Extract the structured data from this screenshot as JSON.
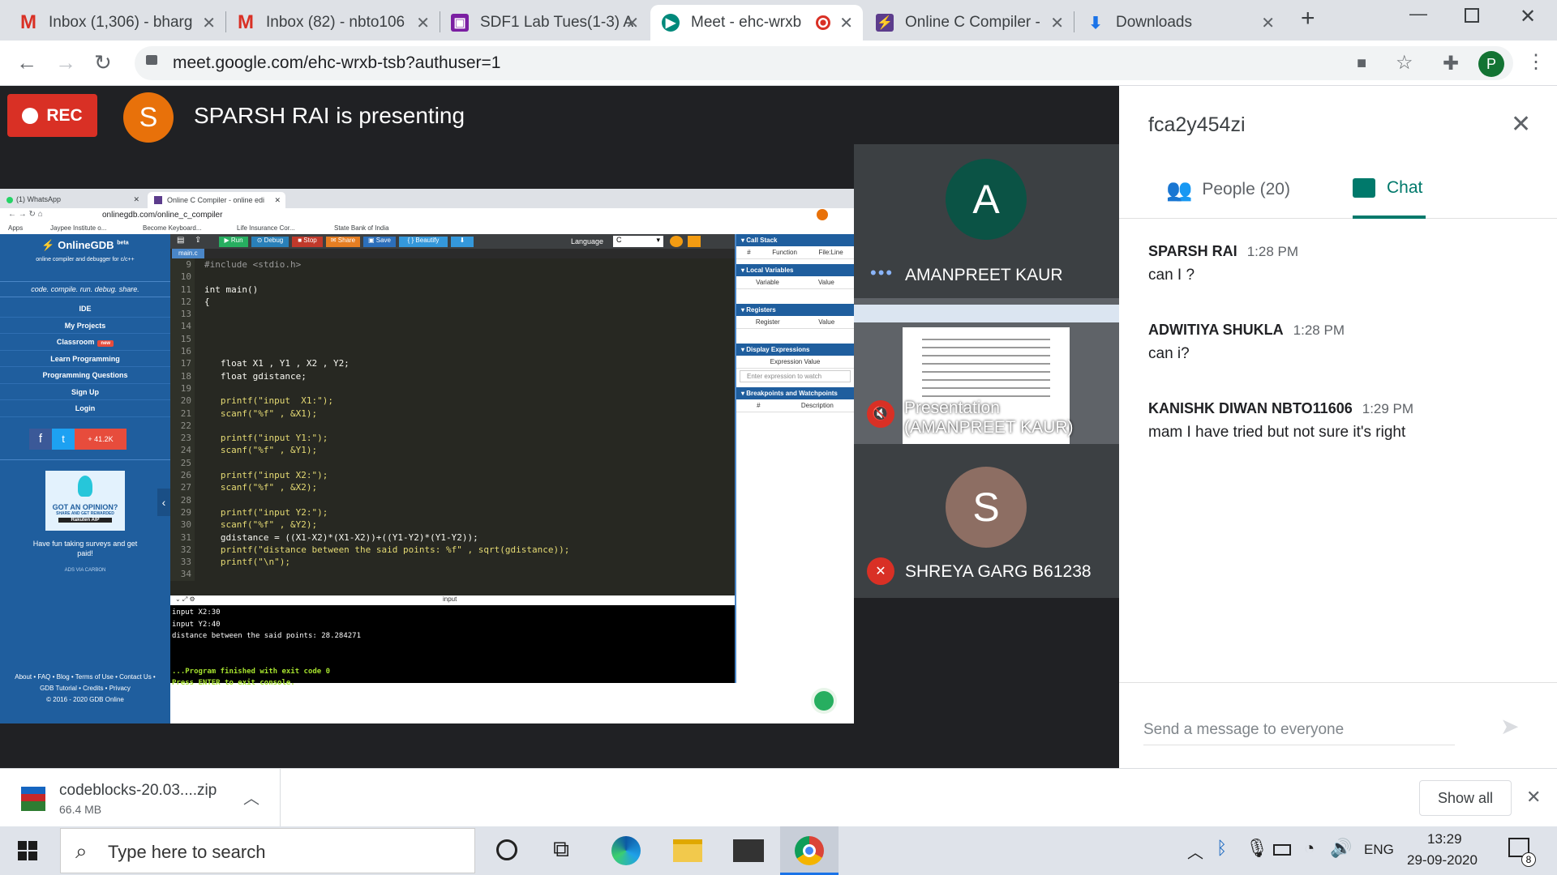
{
  "browser": {
    "tabs": [
      {
        "title": "Inbox (1,306) - bharg",
        "icon": "gmail-icon",
        "active": false
      },
      {
        "title": "Inbox (82) - nbto106",
        "icon": "gmail-icon",
        "active": false
      },
      {
        "title": "SDF1 Lab Tues(1-3) A",
        "icon": "classroom-icon",
        "active": false
      },
      {
        "title": "Meet - ehc-wrxb",
        "icon": "meet-icon",
        "active": true
      },
      {
        "title": "Online C Compiler - ",
        "icon": "onlinegdb-icon",
        "active": false
      },
      {
        "title": "Downloads",
        "icon": "download-icon",
        "active": false
      }
    ],
    "url": "meet.google.com/ehc-wrxb-tsb?authuser=1",
    "profile_letter": "P"
  },
  "meet": {
    "rec_label": "REC",
    "presenter_initial": "S",
    "presenting_text": "SPARSH RAI is presenting",
    "participants": [
      {
        "initial": "A",
        "name": "AMANPREET KAUR",
        "color": "#0b5345"
      },
      {
        "name": "Presentation\n(AMANPREET KAUR)"
      },
      {
        "initial": "S",
        "name": "SHREYA GARG B61238",
        "color": "#8d6e63"
      }
    ]
  },
  "shared_screen": {
    "tabs": [
      "(1) WhatsApp",
      "Online C Compiler - online edi"
    ],
    "url": "onlinegdb.com/online_c_compiler",
    "bookmarks": [
      "Apps",
      "Jaypee Institute o...",
      "Become Keyboard...",
      "Life Insurance Cor...",
      "State Bank of India"
    ],
    "brand": "OnlineGDB",
    "brand_sup": "beta",
    "brand_sub": "online compiler and debugger for c/c++",
    "tagline": "code. compile. run. debug. share.",
    "nav": [
      "IDE",
      "My Projects",
      "Classroom",
      "Learn Programming",
      "Programming Questions",
      "Sign Up",
      "Login"
    ],
    "classroom_badge": "new",
    "share_count": "41.2K",
    "ad_title": "GOT AN OPINION?",
    "ad_sub": "SHARE AND GET REWARDED",
    "ad_brand": "Rakuten AIP",
    "ad_text": "Have fun taking surveys and get paid!",
    "ad_credit": "ADS VIA CARBON",
    "footer": [
      "About • FAQ • Blog • Terms of Use • Contact Us •",
      "GDB Tutorial • Credits • Privacy",
      "© 2016 - 2020 GDB Online"
    ],
    "toolbar": [
      "Run",
      "Debug",
      "Stop",
      "Share",
      "Save",
      "{ } Beautify"
    ],
    "language_label": "Language",
    "language_value": "C",
    "filename": "main.c",
    "code": [
      {
        "n": "9",
        "t": "#include <stdio.h>"
      },
      {
        "n": "10",
        "t": ""
      },
      {
        "n": "11",
        "t": "int main()"
      },
      {
        "n": "12",
        "t": "{"
      },
      {
        "n": "13",
        "t": ""
      },
      {
        "n": "14",
        "t": ""
      },
      {
        "n": "15",
        "t": ""
      },
      {
        "n": "16",
        "t": ""
      },
      {
        "n": "17",
        "t": "   float X1 , Y1 , X2 , Y2;"
      },
      {
        "n": "18",
        "t": "   float gdistance;"
      },
      {
        "n": "19",
        "t": ""
      },
      {
        "n": "20",
        "t": "   printf(\"input  X1:\");"
      },
      {
        "n": "21",
        "t": "   scanf(\"%f\" , &X1);"
      },
      {
        "n": "22",
        "t": ""
      },
      {
        "n": "23",
        "t": "   printf(\"input Y1:\");"
      },
      {
        "n": "24",
        "t": "   scanf(\"%f\" , &Y1);"
      },
      {
        "n": "25",
        "t": ""
      },
      {
        "n": "26",
        "t": "   printf(\"input X2:\");"
      },
      {
        "n": "27",
        "t": "   scanf(\"%f\" , &X2);"
      },
      {
        "n": "28",
        "t": ""
      },
      {
        "n": "29",
        "t": "   printf(\"input Y2:\");"
      },
      {
        "n": "30",
        "t": "   scanf(\"%f\" , &Y2);"
      },
      {
        "n": "31",
        "t": "   gdistance = ((X1-X2)*(X1-X2))+((Y1-Y2)*(Y1-Y2));"
      },
      {
        "n": "32",
        "t": "   printf(\"distance between the said points: %f\" , sqrt(gdistance));"
      },
      {
        "n": "33",
        "t": "   printf(\"\\n\");"
      },
      {
        "n": "34",
        "t": ""
      }
    ],
    "console_label": "input",
    "console": [
      "input X2:30",
      "input Y2:40",
      "distance between the said points: 28.284271",
      "",
      "",
      "...Program finished with exit code 0",
      "Press ENTER to exit console."
    ],
    "debug_sections": [
      {
        "title": "Call Stack",
        "cols": [
          "#",
          "Function",
          "File:Line"
        ]
      },
      {
        "title": "Local Variables",
        "cols": [
          "Variable",
          "Value"
        ]
      },
      {
        "title": "Registers",
        "cols": [
          "Register",
          "Value"
        ]
      },
      {
        "title": "Display Expressions",
        "cols": [
          "Expression Value"
        ]
      },
      {
        "title": "Breakpoints and Watchpoints",
        "cols": [
          "#",
          "Description"
        ]
      }
    ],
    "expr_placeholder": "Enter expression to watch"
  },
  "panel": {
    "meeting_code": "fca2y454zi",
    "people_tab": "People (20)",
    "chat_tab": "Chat",
    "messages": [
      {
        "sender": "SPARSH RAI",
        "time": "1:28 PM",
        "text": "can I ?"
      },
      {
        "sender": "ADWITIYA SHUKLA",
        "time": "1:28 PM",
        "text": "can i?"
      },
      {
        "sender": "KANISHK DIWAN NBTO11606",
        "time": "1:29 PM",
        "text": "mam I have tried but not sure it's right"
      }
    ],
    "input_placeholder": "Send a message to everyone"
  },
  "downloads": {
    "file_name": "codeblocks-20.03....zip",
    "file_size": "66.4 MB",
    "show_all": "Show all"
  },
  "taskbar": {
    "search_placeholder": "Type here to search",
    "lang": "ENG",
    "time": "13:29",
    "date": "29-09-2020",
    "notif_count": "8"
  },
  "colors": {
    "meet_dark": "#202124",
    "rec_red": "#d93025",
    "teal_accent": "#00796b",
    "gdb_blue": "#1f5e9e"
  }
}
